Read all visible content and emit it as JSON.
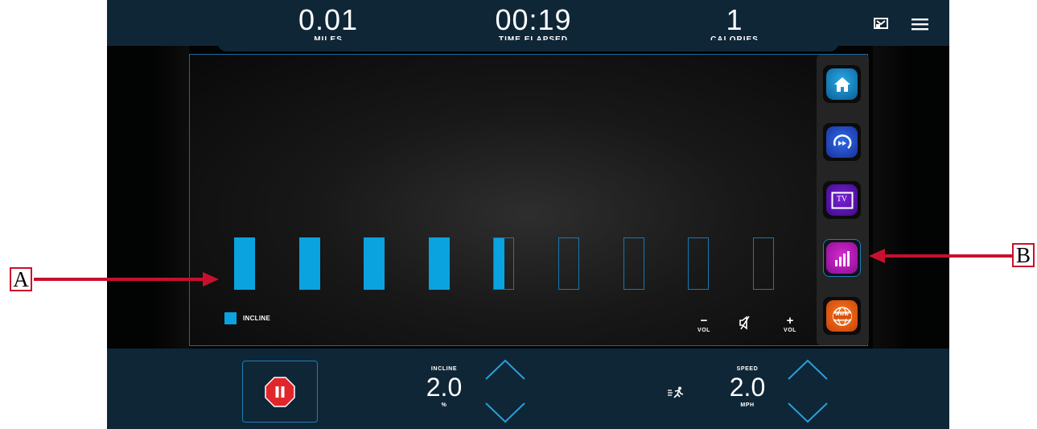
{
  "stats": {
    "miles": {
      "value": "0.01",
      "label": "MILES"
    },
    "time": {
      "value": "00:19",
      "label": "TIME ELAPSED"
    },
    "calories": {
      "value": "1",
      "label": "CALORIES"
    }
  },
  "chart": {
    "legend_label": "INCLINE",
    "bar_fill_levels": [
      1,
      1,
      1,
      1,
      0.5,
      0,
      0,
      0,
      0
    ],
    "bar_color": "#0aa3e0"
  },
  "volume": {
    "down_symbol": "−",
    "up_symbol": "+",
    "label": "VOL"
  },
  "dock": {
    "apps": [
      "home-icon",
      "replay-icon",
      "tv-icon",
      "stats-chart-icon",
      "web-icon"
    ],
    "tv_text": "TV",
    "web_text": "WWW"
  },
  "controls": {
    "incline": {
      "label": "INCLINE",
      "value": "2.0",
      "unit": "%"
    },
    "speed": {
      "label": "SPEED",
      "value": "2.0",
      "unit": "MPH"
    }
  },
  "annotations": {
    "a": "A",
    "b": "B"
  },
  "colors": {
    "bar_accent": "#0aa3e0",
    "panel_bg": "#0f2637",
    "annotation_red": "#c8102e",
    "pause_red": "#e0262b"
  }
}
